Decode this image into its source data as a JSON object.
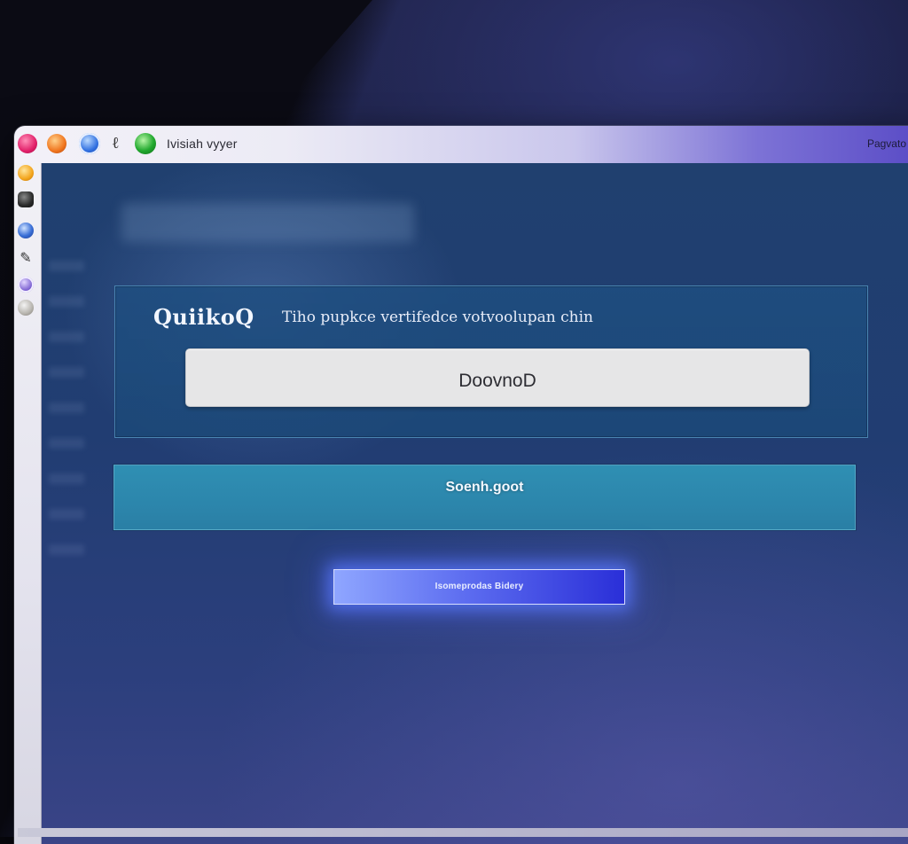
{
  "window": {
    "title": "Ivisiah vyyer",
    "titlebar_right": "Pagvato"
  },
  "titlebar_icons": [
    "app-icon-pink",
    "app-icon-orange",
    "app-icon-blue",
    "app-icon-script",
    "app-icon-green"
  ],
  "sidebar_icons": [
    "folder-icon",
    "camera-icon",
    "globe-icon",
    "tools-icon",
    "gear-icon",
    "clock-icon"
  ],
  "card": {
    "brand": "QuiikoQ",
    "subtitle": "Tiho  pupkce vertifedce votvoolupan chin",
    "input_value": "DoovnoD"
  },
  "buttons": {
    "primary_label": "Soenh.goot",
    "glow_label": "Isomeprodas Bidery"
  },
  "colors": {
    "content_bg": "#213d72",
    "card_bg": "#1e4e80",
    "primary_button": "#2c86ac",
    "glow_button": "#2a2fd8"
  }
}
